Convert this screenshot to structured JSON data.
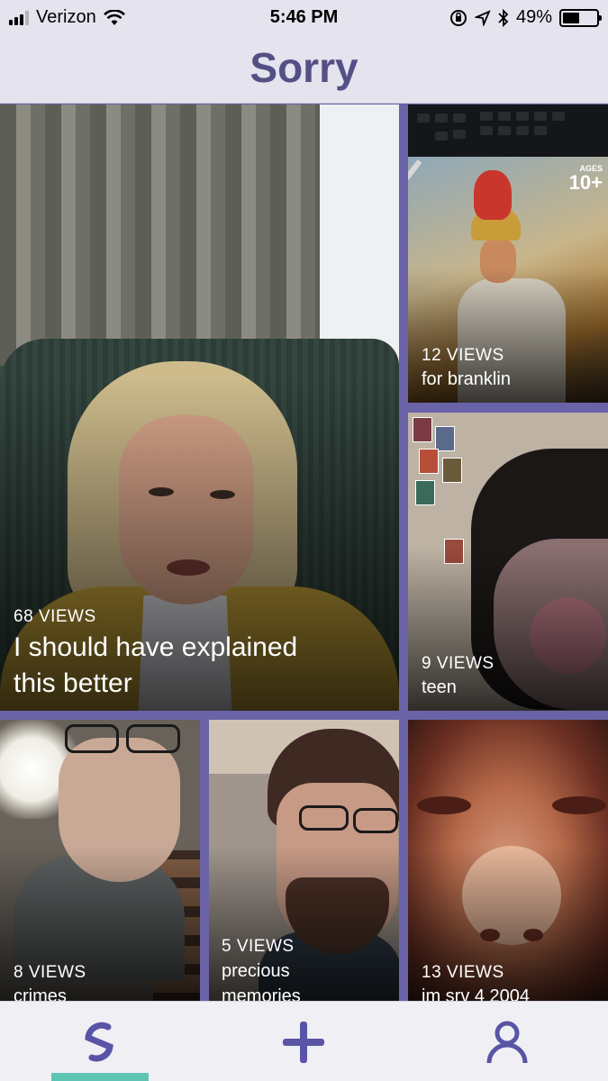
{
  "status_bar": {
    "carrier": "Verizon",
    "time": "5:46 PM",
    "battery_percent": "49%",
    "battery_level": 0.49
  },
  "header": {
    "title": "Sorry"
  },
  "videos": [
    {
      "views": "68 VIEWS",
      "caption_line1": "I should have explained",
      "caption_line2": "this better"
    },
    {
      "views": "12 VIEWS",
      "caption": "for branklin",
      "overlay_top": "AGES",
      "overlay_num": "10+"
    },
    {
      "views": "9 VIEWS",
      "caption": "teen"
    },
    {
      "views": "8 VIEWS",
      "caption": "crimes"
    },
    {
      "views": "5 VIEWS",
      "caption_line1": "precious",
      "caption_line2": "memories"
    },
    {
      "views": "13 VIEWS",
      "caption": "im srv 4 2004"
    }
  ],
  "tabbar": {
    "items": [
      {
        "name": "home",
        "icon": "s-logo-icon",
        "selected": true
      },
      {
        "name": "create",
        "icon": "plus-icon",
        "selected": false
      },
      {
        "name": "profile",
        "icon": "person-icon",
        "selected": false
      }
    ],
    "accent_color": "#5ec5b5",
    "icon_color": "#5a54a6"
  }
}
